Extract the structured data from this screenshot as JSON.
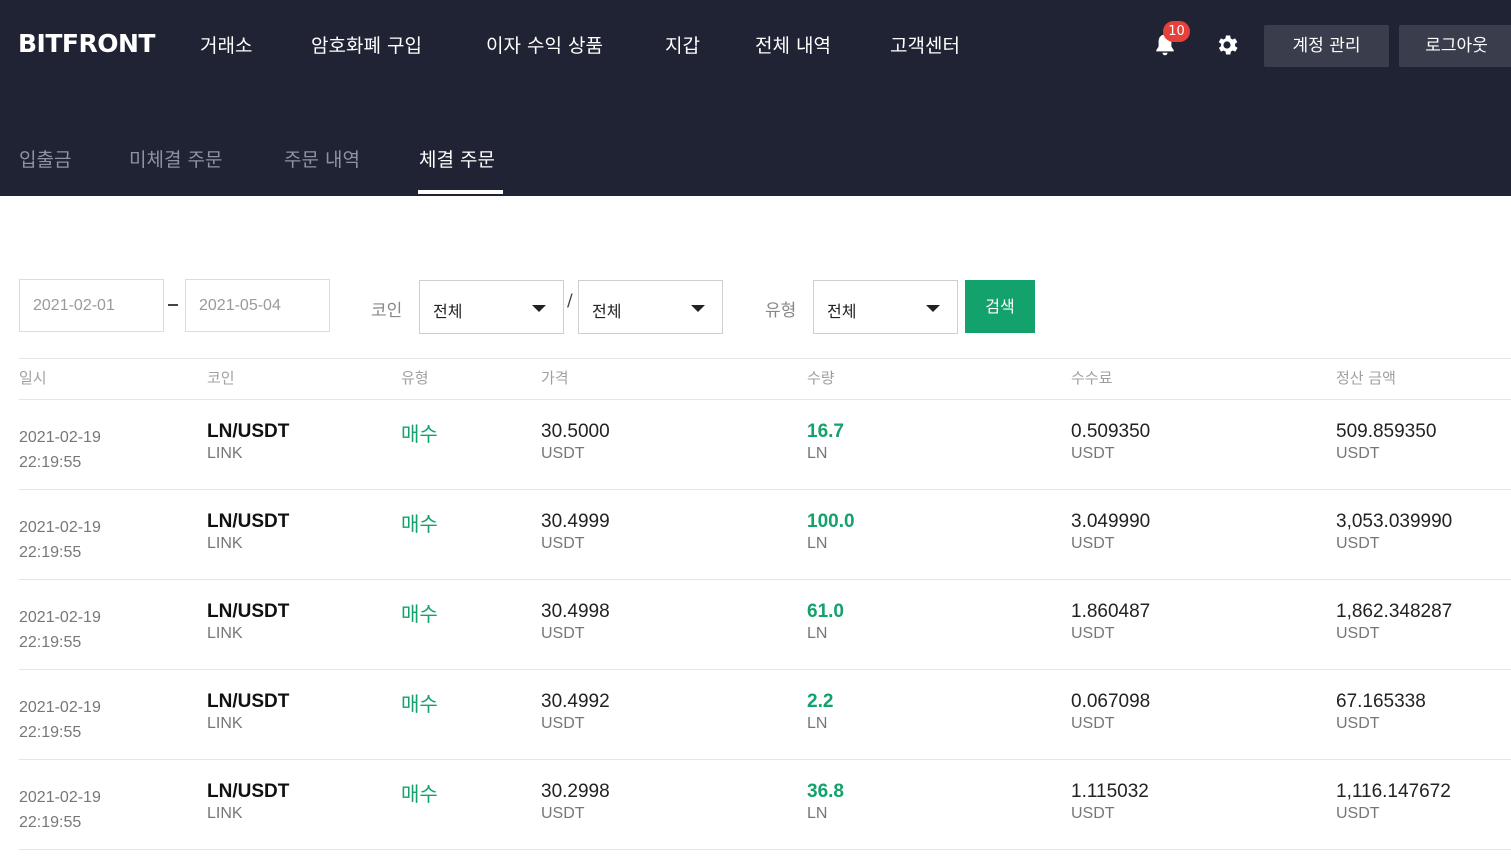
{
  "header": {
    "logo": "BITFRONT",
    "nav": [
      {
        "label": "거래소"
      },
      {
        "label": "암호화폐 구입"
      },
      {
        "label": "이자 수익 상품"
      },
      {
        "label": "지갑"
      },
      {
        "label": "전체 내역"
      },
      {
        "label": "고객센터"
      }
    ],
    "notification_count": "10",
    "account_label": "계정 관리",
    "logout_label": "로그아웃"
  },
  "subnav": {
    "tabs": [
      {
        "label": "입출금",
        "active": false
      },
      {
        "label": "미체결 주문",
        "active": false
      },
      {
        "label": "주문 내역",
        "active": false
      },
      {
        "label": "체결 주문",
        "active": true
      }
    ]
  },
  "filters": {
    "date_from": "2021-02-01",
    "date_to": "2021-05-04",
    "coin_label": "코인",
    "coin_base": "전체",
    "coin_quote": "전체",
    "type_label": "유형",
    "type_value": "전체",
    "search_label": "검색"
  },
  "table": {
    "headers": [
      "일시",
      "코인",
      "유형",
      "가격",
      "수량",
      "수수료",
      "정산 금액"
    ],
    "rows": [
      {
        "date": "2021-02-19",
        "time": "22:19:55",
        "pair": "LN/USDT",
        "coin_name": "LINK",
        "type": "매수",
        "price": "30.5000",
        "price_unit": "USDT",
        "qty": "16.7",
        "qty_unit": "LN",
        "fee": "0.509350",
        "fee_unit": "USDT",
        "total": "509.859350",
        "total_unit": "USDT"
      },
      {
        "date": "2021-02-19",
        "time": "22:19:55",
        "pair": "LN/USDT",
        "coin_name": "LINK",
        "type": "매수",
        "price": "30.4999",
        "price_unit": "USDT",
        "qty": "100.0",
        "qty_unit": "LN",
        "fee": "3.049990",
        "fee_unit": "USDT",
        "total": "3,053.039990",
        "total_unit": "USDT"
      },
      {
        "date": "2021-02-19",
        "time": "22:19:55",
        "pair": "LN/USDT",
        "coin_name": "LINK",
        "type": "매수",
        "price": "30.4998",
        "price_unit": "USDT",
        "qty": "61.0",
        "qty_unit": "LN",
        "fee": "1.860487",
        "fee_unit": "USDT",
        "total": "1,862.348287",
        "total_unit": "USDT"
      },
      {
        "date": "2021-02-19",
        "time": "22:19:55",
        "pair": "LN/USDT",
        "coin_name": "LINK",
        "type": "매수",
        "price": "30.4992",
        "price_unit": "USDT",
        "qty": "2.2",
        "qty_unit": "LN",
        "fee": "0.067098",
        "fee_unit": "USDT",
        "total": "67.165338",
        "total_unit": "USDT"
      },
      {
        "date": "2021-02-19",
        "time": "22:19:55",
        "pair": "LN/USDT",
        "coin_name": "LINK",
        "type": "매수",
        "price": "30.2998",
        "price_unit": "USDT",
        "qty": "36.8",
        "qty_unit": "LN",
        "fee": "1.115032",
        "fee_unit": "USDT",
        "total": "1,116.147672",
        "total_unit": "USDT"
      }
    ]
  },
  "colors": {
    "header_bg": "#1f2334",
    "accent_green": "#13a26b",
    "badge_red": "#e6403a"
  }
}
